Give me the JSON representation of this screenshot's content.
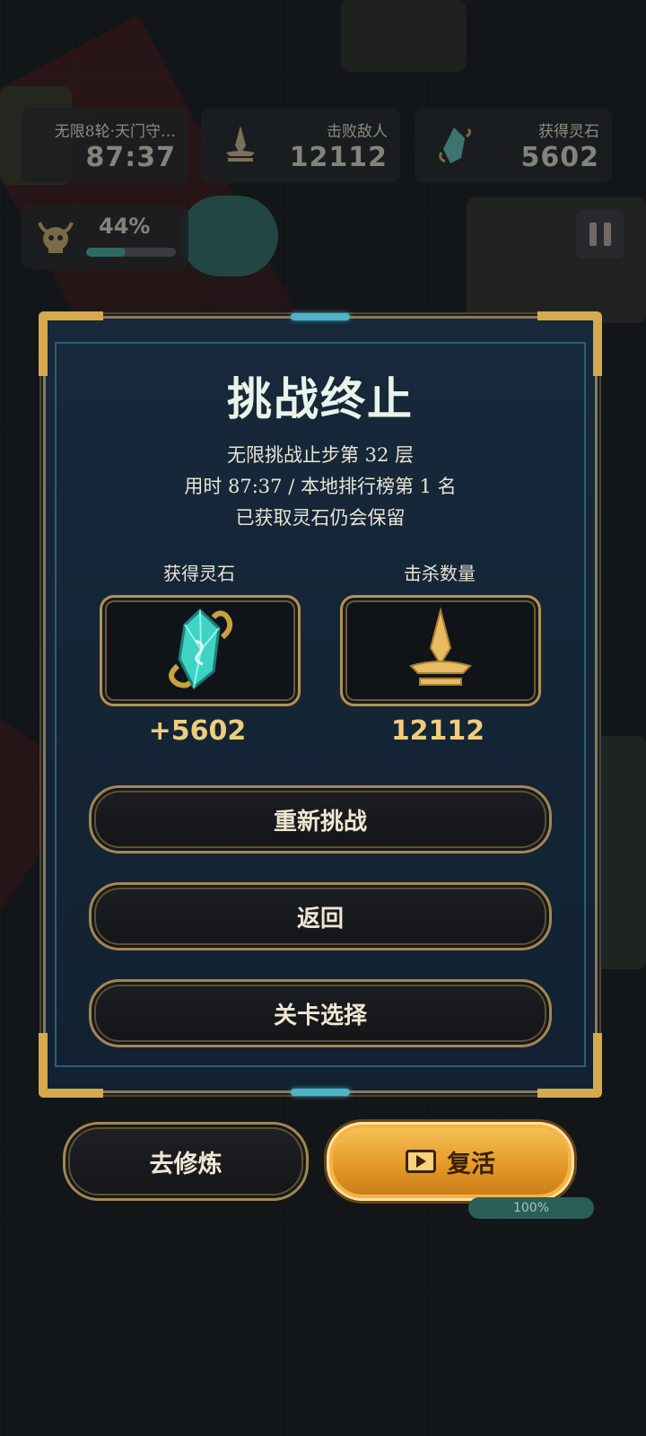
{
  "hud": {
    "stage": {
      "label": "无限8轮·天门守…",
      "value": "87:37"
    },
    "kills": {
      "label": "击败敌人",
      "value": "12112",
      "icon": "spire-icon"
    },
    "stones": {
      "label": "获得灵石",
      "value": "5602",
      "icon": "spirit-stone-icon"
    },
    "boss": {
      "percent_text": "44%",
      "progress": 0.44,
      "icon": "demon-skull-icon"
    },
    "pause": {
      "icon": "pause-icon"
    }
  },
  "dialog": {
    "title": "挑战终止",
    "lines": [
      "无限挑战止步第 32 层",
      "用时 87:37  /  本地排行榜第 1 名",
      "已获取灵石仍会保留"
    ],
    "rewards": [
      {
        "label": "获得灵石",
        "value": "+5602",
        "icon": "spirit-stone-icon"
      },
      {
        "label": "击杀数量",
        "value": "12112",
        "icon": "spire-icon"
      }
    ],
    "buttons": {
      "retry": "重新挑战",
      "back": "返回",
      "level_select": "关卡选择"
    }
  },
  "bottom": {
    "train": "去修炼",
    "revive": "复活",
    "revive_icon": "video-play-icon",
    "progress_text": "100%"
  },
  "colors": {
    "gold": "#d6a94c",
    "value_gold": "#f0cd7a",
    "teal": "#4fb4c8",
    "revive_orange": "#e59a28"
  }
}
